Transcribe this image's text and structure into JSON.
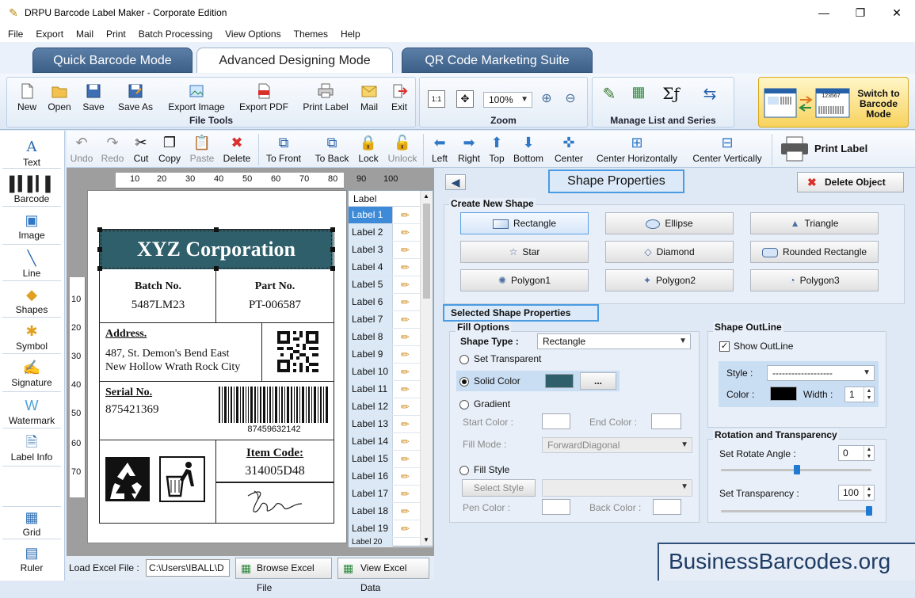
{
  "window": {
    "title": "DRPU Barcode Label Maker - Corporate Edition",
    "controls": [
      "—",
      "❐",
      "✕"
    ]
  },
  "menu": [
    "File",
    "Export",
    "Mail",
    "Print",
    "Batch Processing",
    "View Options",
    "Themes",
    "Help"
  ],
  "mode_tabs": [
    {
      "label": "Quick Barcode Mode",
      "active": false
    },
    {
      "label": "Advanced Designing Mode",
      "active": true
    },
    {
      "label": "QR Code Marketing Suite",
      "active": false
    }
  ],
  "ribbon": {
    "file_tools": {
      "label": "File Tools",
      "buttons": [
        "New",
        "Open",
        "Save",
        "Save As",
        "Export Image",
        "Export PDF",
        "Print Label",
        "Mail",
        "Exit"
      ]
    },
    "zoom": {
      "label": "Zoom",
      "value": "100%"
    },
    "manage": {
      "label": "Manage List and Series"
    },
    "switch_label": "Switch to Barcode Mode",
    "switch_code": "123567"
  },
  "toolbar": {
    "buttons": [
      {
        "label": "Undo",
        "enabled": false
      },
      {
        "label": "Redo",
        "enabled": false
      },
      {
        "label": "Cut",
        "enabled": true
      },
      {
        "label": "Copy",
        "enabled": true
      },
      {
        "label": "Paste",
        "enabled": false
      },
      {
        "label": "Delete",
        "enabled": true
      },
      {
        "label": "To Front",
        "enabled": true
      },
      {
        "label": "To Back",
        "enabled": true
      },
      {
        "label": "Lock",
        "enabled": true
      },
      {
        "label": "Unlock",
        "enabled": false
      },
      {
        "label": "Left",
        "enabled": true
      },
      {
        "label": "Right",
        "enabled": true
      },
      {
        "label": "Top",
        "enabled": true
      },
      {
        "label": "Bottom",
        "enabled": true
      },
      {
        "label": "Center",
        "enabled": true
      },
      {
        "label": "Center Horizontally",
        "enabled": true
      },
      {
        "label": "Center Vertically",
        "enabled": true
      }
    ],
    "print_label": "Print Label"
  },
  "left_tools": [
    "Text",
    "Barcode",
    "Image",
    "Line",
    "Shapes",
    "Symbol",
    "Signature",
    "Watermark",
    "Label Info",
    "Grid",
    "Ruler"
  ],
  "ruler": {
    "top_ticks": [
      "10",
      "20",
      "30",
      "40",
      "50",
      "60",
      "70",
      "80",
      "90",
      "100"
    ],
    "left_ticks": [
      "10",
      "20",
      "30",
      "40",
      "50",
      "60",
      "70"
    ]
  },
  "label_design": {
    "company": "XYZ Corporation",
    "header_color": "#2f5f6b",
    "batch_title": "Batch No.",
    "batch_value": "5487LM23",
    "part_title": "Part No.",
    "part_value": "PT-006587",
    "address_title": "Address.",
    "address_line1": "487, St. Demon's Bend East",
    "address_line2": "New Hollow Wrath Rock City",
    "serial_title": "Serial No.",
    "serial_value": "875421369",
    "barcode_text": "87459632142",
    "item_title": "Item Code:",
    "item_value": "314005D48"
  },
  "label_list": {
    "header": "Label",
    "items": [
      "Label 1",
      "Label 2",
      "Label 3",
      "Label 4",
      "Label 5",
      "Label 6",
      "Label 7",
      "Label 8",
      "Label 9",
      "Label 10",
      "Label 11",
      "Label 12",
      "Label 13",
      "Label 14",
      "Label 15",
      "Label 16",
      "Label 17",
      "Label 18",
      "Label 19",
      "Label 20"
    ],
    "selected": "Label 1"
  },
  "bottom": {
    "load_excel_label": "Load Excel File :",
    "excel_path": "C:\\Users\\IBALL\\D",
    "browse": "Browse Excel File",
    "view": "View Excel Data"
  },
  "properties": {
    "title": "Shape Properties",
    "delete_object": "Delete Object",
    "create_new_shape": "Create New Shape",
    "shapes": [
      "Rectangle",
      "Ellipse",
      "Triangle",
      "Star",
      "Diamond",
      "Rounded Rectangle",
      "Polygon1",
      "Polygon2",
      "Polygon3"
    ],
    "selected_shape_props": "Selected Shape Properties",
    "fill_options": "Fill Options",
    "shape_type_label": "Shape Type :",
    "shape_type": "Rectangle",
    "set_transparent": "Set Transparent",
    "solid_color": "Solid Color",
    "solid_color_value": "#2f5f6b",
    "browse_dots": "...",
    "gradient": "Gradient",
    "start_color": "Start Color :",
    "end_color": "End Color :",
    "fill_mode": "Fill Mode :",
    "fill_mode_value": "ForwardDiagonal",
    "fill_style": "Fill Style",
    "select_style": "Select Style",
    "pen_color": "Pen Color :",
    "back_color": "Back Color :",
    "shape_outline": "Shape OutLine",
    "show_outline": "Show OutLine",
    "style_label": "Style :",
    "style_value": "-------------------",
    "color_label": "Color :",
    "outline_color": "#000000",
    "width_label": "Width :",
    "width_value": "1",
    "rotation_title": "Rotation and Transparency",
    "rotate_label": "Set Rotate Angle :",
    "rotate_value": "0",
    "transparency_label": "Set Transparency :",
    "transparency_value": "100"
  },
  "watermark": "BusinessBarcodes.org"
}
